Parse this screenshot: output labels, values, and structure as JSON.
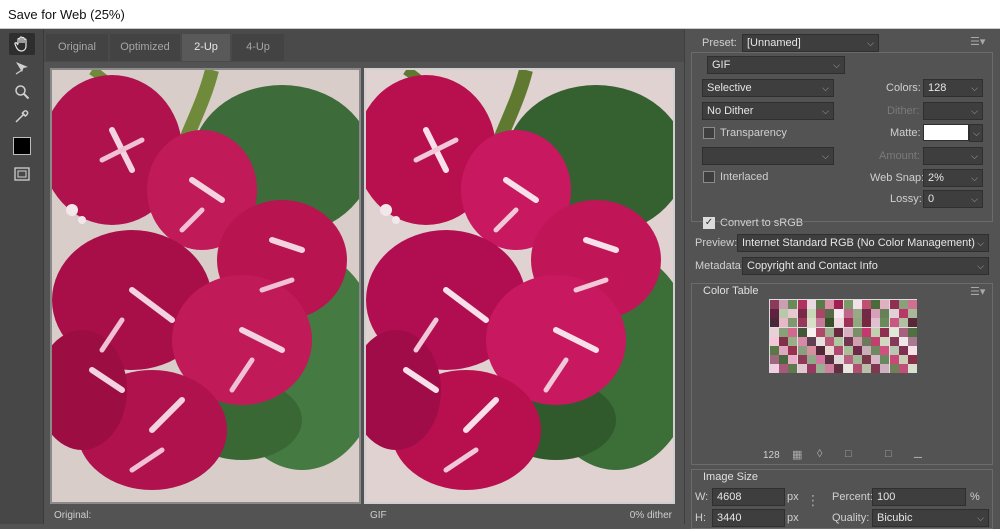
{
  "window": {
    "title": "Save for Web (25%)"
  },
  "tabs": [
    {
      "label": "Original"
    },
    {
      "label": "Optimized"
    },
    {
      "label": "2-Up"
    },
    {
      "label": "4-Up"
    }
  ],
  "panes": {
    "left_label": "Original:",
    "right_label": "GIF",
    "right_dither": "0% dither"
  },
  "preset": {
    "label": "Preset:",
    "value": "[Unnamed]"
  },
  "settings": {
    "format": "GIF",
    "reduction": "Selective",
    "dither_algo": "No Dither",
    "colors_label": "Colors:",
    "colors_value": "128",
    "dither_label": "Dither:",
    "transparency_label": "Transparency",
    "matte_label": "Matte:",
    "amount_label": "Amount:",
    "interlaced_label": "Interlaced",
    "websnap_label": "Web Snap:",
    "websnap_value": "2%",
    "lossy_label": "Lossy:",
    "lossy_value": "0",
    "convert_label": "Convert to sRGB",
    "convert_checked": true,
    "preview_label": "Preview:",
    "preview_value": "Internet Standard RGB (No Color Management)",
    "metadata_label": "Metadata:",
    "metadata_value": "Copyright and Contact Info"
  },
  "color_table": {
    "title": "Color Table",
    "count": "128",
    "swatches": [
      "#8a3b5a",
      "#c9a0b0",
      "#6b8a5a",
      "#b03060",
      "#e8d8e0",
      "#5a7a4a",
      "#d890a8",
      "#a02050",
      "#7a9a6a",
      "#f0e0e8",
      "#c05070",
      "#4a6a3a",
      "#e0b0c0",
      "#903050",
      "#8aa07a",
      "#d07090",
      "#602040",
      "#b8c8a8",
      "#e8c8d0",
      "#7a2848",
      "#c8d8b8",
      "#a84868",
      "#586848",
      "#f8e8f0",
      "#c06888",
      "#98a888",
      "#702a48",
      "#d8a0b8",
      "#688058",
      "#e0d0d8",
      "#b83868",
      "#a8b898",
      "#482838",
      "#e8b8c8",
      "#809870",
      "#983858",
      "#d8e0c8",
      "#c87898",
      "#385028",
      "#f0d8e0",
      "#a03058",
      "#90a880",
      "#782840",
      "#e0c0d0",
      "#6a8a5a",
      "#c85880",
      "#b0c0a0",
      "#582838",
      "#e8d0d8",
      "#88a078",
      "#d06890",
      "#405838",
      "#f8f0f0",
      "#b04868",
      "#a0b090",
      "#682840",
      "#d8b0c0",
      "#789068",
      "#c83870",
      "#c0d0b0",
      "#903050",
      "#e0e8d8",
      "#a86080",
      "#507040",
      "#f0c8d8",
      "#803048",
      "#98b088",
      "#d888a8",
      "#604050",
      "#e8e0e0",
      "#b85878",
      "#b0c8a0",
      "#703850",
      "#d0a0b0",
      "#6a7a5a",
      "#c04070",
      "#d0d8c0",
      "#883858",
      "#f0e8e8",
      "#a87890",
      "#587848",
      "#e0a8c0",
      "#983050",
      "#88a080",
      "#d890a0",
      "#502838",
      "#e8d8d0",
      "#b04870",
      "#a8c098",
      "#702848",
      "#c8b0b8",
      "#708860",
      "#d05080",
      "#b8c8b0",
      "#803050",
      "#f8e0e8",
      "#a06880",
      "#486840",
      "#e8b0c8",
      "#903858",
      "#90a888",
      "#d078a0",
      "#583040",
      "#e0d8d8",
      "#b86080",
      "#a0b898",
      "#783848",
      "#d8b8c8",
      "#688860",
      "#c84878",
      "#c8d0b8",
      "#883048",
      "#f0d0e0",
      "#a85878",
      "#607850",
      "#e0c8d0",
      "#983860",
      "#98b090",
      "#d080a0",
      "#603040",
      "#e8e8e0",
      "#b05070",
      "#b8c0a8",
      "#803850",
      "#d0b0c0",
      "#708058",
      "#c05078",
      "#d8e0d0"
    ]
  },
  "image_size": {
    "title": "Image Size",
    "w_label": "W:",
    "w_value": "4608",
    "h_label": "H:",
    "h_value": "3440",
    "unit": "px",
    "percent_label": "Percent:",
    "percent_value": "100",
    "percent_unit": "%",
    "quality_label": "Quality:",
    "quality_value": "Bicubic"
  }
}
